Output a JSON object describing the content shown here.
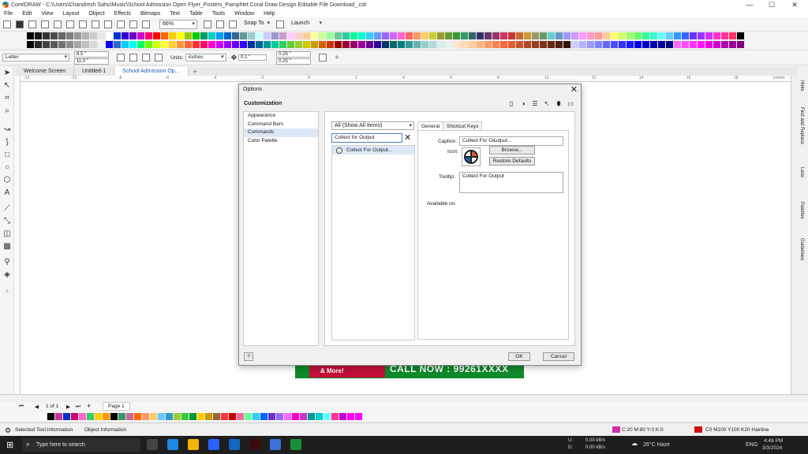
{
  "window": {
    "title": "CorelDRAW - C:\\Users\\Chandresh Sahu\\Music\\School Admission Open Flyer_Posters_Pamphlet Coral Draw Design Editable File Download_.cdr",
    "controls": [
      "—",
      "☐",
      "✕"
    ]
  },
  "menu": [
    "File",
    "Edit",
    "View",
    "Layout",
    "Object",
    "Effects",
    "Bitmaps",
    "Text",
    "Table",
    "Tools",
    "Window",
    "Help"
  ],
  "toolbar": {
    "zoom": "66%",
    "snap_label": "Snap To",
    "launch_label": "Launch"
  },
  "propbar": {
    "page_size": "Letter",
    "width": "8.5 \"",
    "height": "11.0 \"",
    "units_label": "Units:",
    "units_value": "inches",
    "nudge": "0.1 \"",
    "dup_x": "0.25 \"",
    "dup_y": "0.25 \""
  },
  "doc_tabs": [
    "Welcome Screen",
    "Untitled-1",
    "School Admission Op..."
  ],
  "ruler": {
    "ticks": [
      "-12",
      "-10",
      "-8",
      "-6",
      "-4",
      "-2",
      "0",
      "2",
      "4",
      "6",
      "8",
      "10",
      "12",
      "14",
      "16",
      "18"
    ],
    "unit": "inches"
  },
  "dockers": [
    "Hints",
    "Find and Replace",
    "Lens",
    "Palettes",
    "Guidelines"
  ],
  "canvas_banner": {
    "left_text": "& More!",
    "call_text": "CALL NOW : 99261XXXX"
  },
  "dialog": {
    "title": "Options",
    "close": "✕",
    "heading": "Customization",
    "tree": [
      "Appearance",
      "Command Bars",
      "Commands",
      "Color Palette"
    ],
    "selected_tree": "Commands",
    "filter_value": "All (Show All Items)",
    "search_value": "Collect for Output",
    "command_item": "Collect For Output...",
    "tabs": [
      "General",
      "Shortcut Keys"
    ],
    "caption_label": "Caption:",
    "caption_value": "Collect For O&utput...",
    "icon_label": "Icon:",
    "browse_label": "Browse...",
    "restore_label": "Restore Defaults",
    "tooltip_label": "Tooltip:",
    "tooltip_value": "Collect For Output",
    "available_label": "Available on:",
    "help_label": "?",
    "ok_label": "OK",
    "cancel_label": "Cancel"
  },
  "pagenav": {
    "page_of": "1 of 1",
    "page_tab": "Page 1"
  },
  "status": {
    "tool_info": "Selected Tool Information",
    "object_info": "Object Information",
    "fill": "C:20 M:80 Y:0 K:0",
    "outline": "C0 M100 Y100 K20  Hairline"
  },
  "taskbar": {
    "search_placeholder": "Type here to search",
    "net_up": "0.00 kB/s",
    "net_down": "0.00 kB/s",
    "net_up_label": "U:",
    "net_down_label": "D:",
    "weather": "26°C  Haze",
    "lang": "ENG",
    "time": "4:49 PM",
    "date": "3/3/2024"
  },
  "palette_colors_row1": [
    "#000000",
    "#1a1a1a",
    "#333333",
    "#4d4d4d",
    "#666666",
    "#808080",
    "#999999",
    "#b3b3b3",
    "#cccccc",
    "#e6e6e6",
    "#ffffff",
    "#0033cc",
    "#3300cc",
    "#6600cc",
    "#cc00cc",
    "#ff0066",
    "#ff0000",
    "#ff6600",
    "#ffcc00",
    "#ffff00",
    "#99cc00",
    "#00cc00",
    "#009966",
    "#00cccc",
    "#0099ff",
    "#0066cc",
    "#336699",
    "#669999",
    "#99cccc",
    "#ccffff",
    "#ccccff",
    "#9999cc",
    "#cc99cc",
    "#ffccff",
    "#ffcccc",
    "#ffcc99",
    "#ffff99",
    "#ccff99",
    "#99ff99",
    "#66cc99",
    "#33cc99",
    "#00ff99",
    "#00ffcc",
    "#33ccff",
    "#6699ff",
    "#9966ff",
    "#cc66ff",
    "#ff66cc",
    "#ff6666",
    "#ff9966",
    "#ffcc66",
    "#cccc33",
    "#999933",
    "#669933",
    "#339933",
    "#339966",
    "#336666",
    "#333366",
    "#663366",
    "#993366",
    "#cc3366",
    "#cc3333",
    "#cc6633",
    "#cc9933",
    "#999966",
    "#669966",
    "#66cccc",
    "#6699cc",
    "#9999ff",
    "#cc99ff",
    "#ff99ff",
    "#ff99cc",
    "#ff9999",
    "#ffcc99",
    "#ffff66",
    "#ccff66",
    "#99ff66",
    "#66ff66",
    "#33ff99",
    "#33ffcc",
    "#66ffff",
    "#66ccff",
    "#3399ff",
    "#3366ff",
    "#6633ff",
    "#9933ff",
    "#cc33ff",
    "#ff33cc",
    "#ff3399",
    "#ff3366",
    "#000000"
  ],
  "palette_colors_row2": [
    "#000000",
    "#262626",
    "#404040",
    "#595959",
    "#737373",
    "#8c8c8c",
    "#a6a6a6",
    "#bfbfbf",
    "#d9d9d9",
    "#f2f2f2",
    "#0000ff",
    "#3366cc",
    "#00ccff",
    "#00ffff",
    "#00ff66",
    "#66ff00",
    "#ccff00",
    "#ffff33",
    "#ffcc33",
    "#ff9933",
    "#ff6633",
    "#ff3333",
    "#ff0066",
    "#ff00cc",
    "#cc00ff",
    "#9900ff",
    "#6600ff",
    "#3300ff",
    "#003399",
    "#006699",
    "#009999",
    "#00cc99",
    "#33cc66",
    "#66cc33",
    "#99cc33",
    "#cccc00",
    "#cc9900",
    "#cc6600",
    "#cc3300",
    "#990000",
    "#990033",
    "#990066",
    "#990099",
    "#660099",
    "#330099",
    "#003366",
    "#006666",
    "#008080",
    "#339999",
    "#66b2b2",
    "#99cccc",
    "#b2d8d8",
    "#d9ecec",
    "#e5f2f2",
    "#ffe5cc",
    "#ffd9b3",
    "#ffcc99",
    "#ffb380",
    "#ff9966",
    "#ff804d",
    "#ff6633",
    "#e65c2e",
    "#cc5229",
    "#b34724",
    "#993d1f",
    "#80331a",
    "#662914",
    "#4d1f0f",
    "#33140a",
    "#ccccff",
    "#b3b3ff",
    "#9999ff",
    "#8080ff",
    "#6666ff",
    "#4d4dff",
    "#3333ff",
    "#1a1aff",
    "#0000e6",
    "#0000cc",
    "#0000b3",
    "#000099",
    "#000080",
    "#ff66ff",
    "#ff4dff",
    "#ff33ff",
    "#ff1aff",
    "#e600e6",
    "#cc00cc",
    "#b300b3",
    "#990099",
    "#800080"
  ],
  "doc_palette": [
    "#ffffff",
    "#000000",
    "#cc3399",
    "#0033cc",
    "#cc0066",
    "#ff66cc",
    "#33cc66",
    "#ffcc00",
    "#ff9900",
    "#000000",
    "#339966",
    "#cc6699",
    "#ff6600",
    "#ff9966",
    "#ffcc66",
    "#66ccff",
    "#3399cc",
    "#99cc33",
    "#33cc33",
    "#009933",
    "#ffcc00",
    "#cc9900",
    "#996633",
    "#ff3333",
    "#cc0000",
    "#ff6699",
    "#66ff99",
    "#33ccff",
    "#0066ff",
    "#6633cc",
    "#9966ff",
    "#ff66ff",
    "#ff00cc",
    "#cc33cc",
    "#009999",
    "#00cccc",
    "#66ffff",
    "#ff3399",
    "#cc00cc",
    "#ff00ff",
    "#ff00ff"
  ]
}
